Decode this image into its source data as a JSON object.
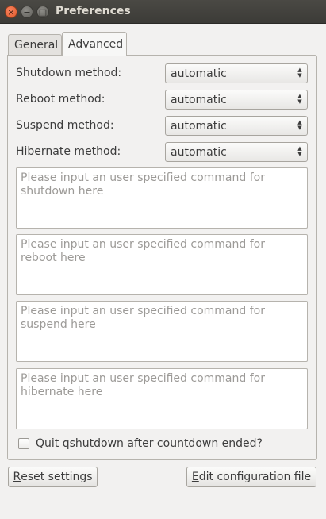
{
  "window": {
    "title": "Preferences",
    "close_glyph": "×",
    "minimize_glyph": "−",
    "maximize_glyph": "□"
  },
  "tabs": [
    {
      "label": "General",
      "selected": false
    },
    {
      "label": "Advanced",
      "selected": true
    }
  ],
  "methods": [
    {
      "label": "Shutdown method:",
      "value": "automatic"
    },
    {
      "label": "Reboot method:",
      "value": "automatic"
    },
    {
      "label": "Suspend method:",
      "value": "automatic"
    },
    {
      "label": "Hibernate method:",
      "value": "automatic"
    }
  ],
  "commands": [
    {
      "placeholder": "Please input an user specified command for shutdown here"
    },
    {
      "placeholder": "Please input an user specified command for reboot here"
    },
    {
      "placeholder": "Please input an user specified command for suspend here"
    },
    {
      "placeholder": "Please input an user specified command for hibernate here"
    }
  ],
  "quit_after_countdown": {
    "label": "Quit qshutdown after countdown ended?",
    "checked": false
  },
  "buttons": {
    "reset": {
      "mnemonic": "R",
      "rest": "eset settings"
    },
    "edit": {
      "mnemonic": "E",
      "rest": "dit configuration file"
    }
  }
}
